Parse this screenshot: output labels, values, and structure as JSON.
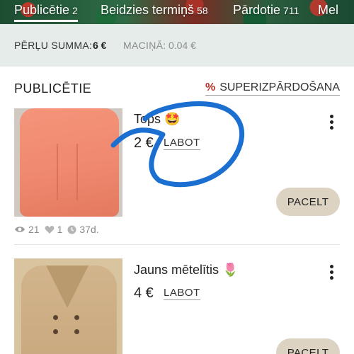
{
  "tabs": [
    {
      "label": "Publicētie",
      "count": "2",
      "active": true
    },
    {
      "label": "Beidzies termiņš",
      "count": "58",
      "active": false
    },
    {
      "label": "Pārdotie",
      "count": "711",
      "active": false
    },
    {
      "label": "Mel",
      "count": "",
      "active": false
    }
  ],
  "summary": {
    "sum_label": "PĒRĻU SUMMA:",
    "sum_value": "6 €",
    "wallet_label": "MACIŅĀ:",
    "wallet_value": "0.04 €"
  },
  "section": {
    "title": "PUBLICĒTIE",
    "promo_icon": "%",
    "promo_label": "SUPERIZPĀRDOŠANA"
  },
  "items": [
    {
      "title": "Tops 🤩",
      "price": "2 €",
      "edit_label": "LABOT",
      "bump_label": "PACELT",
      "views": "21",
      "likes": "1",
      "age": "37d."
    },
    {
      "title": "Jauns mētelītis 🌷",
      "price": "4 €",
      "edit_label": "LABOT",
      "bump_label": "PACELT"
    }
  ],
  "icons": {
    "views": "eye-icon",
    "likes": "heart-icon",
    "age": "clock-icon",
    "menu": "kebab-menu-icon"
  },
  "colors": {
    "summary_bg": "#e6ece9",
    "bump_bg": "#ddd3c2",
    "promo_accent": "#b3322a",
    "annotation": "#1a6fd1"
  }
}
